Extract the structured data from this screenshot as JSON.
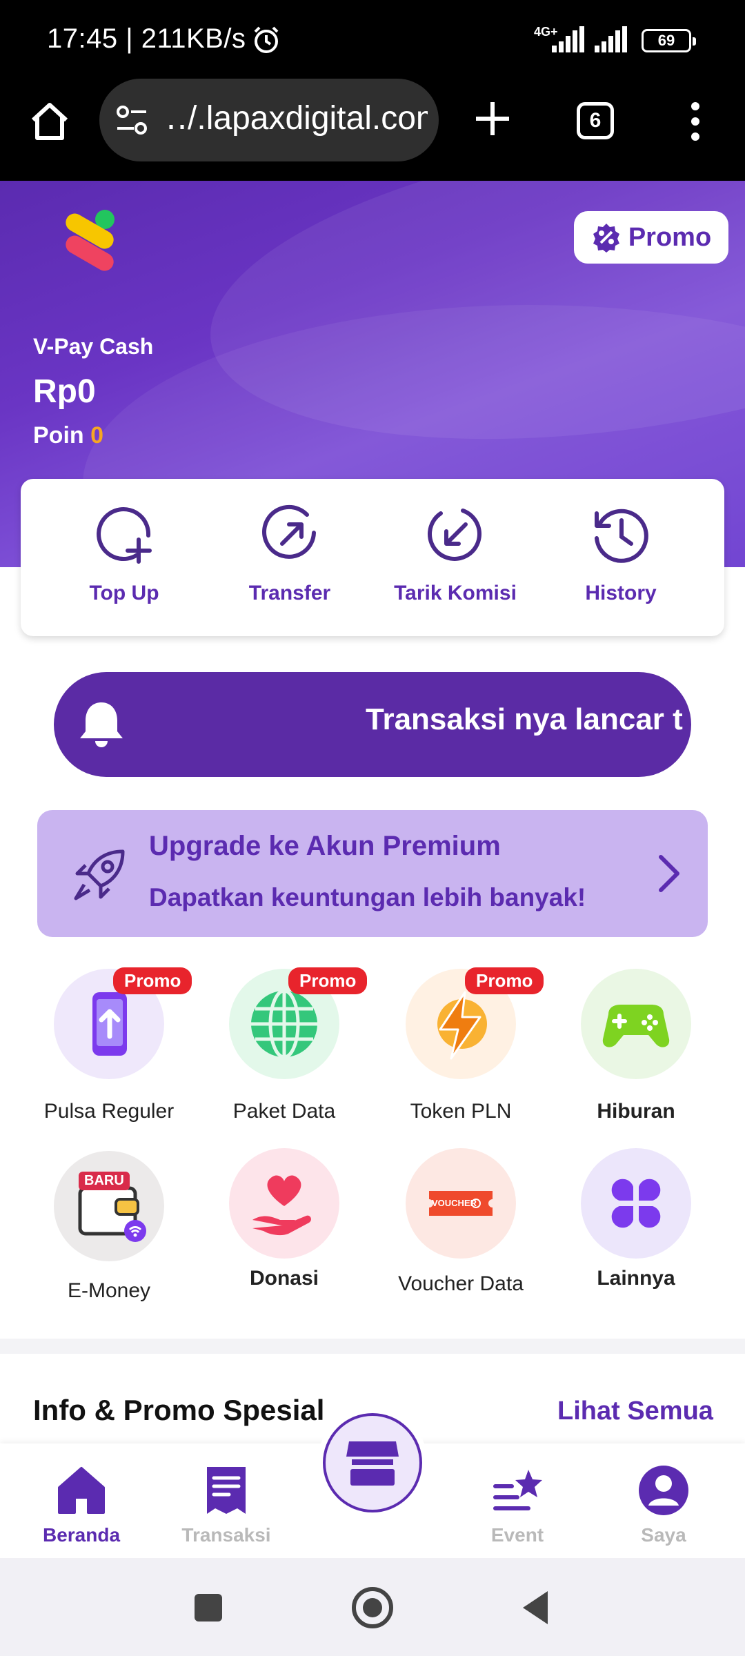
{
  "status_bar": {
    "time": "17:45 | 211KB/s",
    "network": "4G+",
    "battery": "69"
  },
  "browser": {
    "url": "‥/.lapaxdigital.com",
    "tab_count": "6"
  },
  "hero": {
    "promo_label": "Promo",
    "wallet_label": "V-Pay Cash",
    "balance": "Rp0",
    "points_label": "Poin",
    "points_value": "0"
  },
  "actions": [
    {
      "label": "Top Up",
      "icon": "add-circle-icon"
    },
    {
      "label": "Transfer",
      "icon": "transfer-arrow-icon"
    },
    {
      "label": "Tarik Komisi",
      "icon": "withdraw-arrow-icon"
    },
    {
      "label": "History",
      "icon": "history-clock-icon"
    }
  ],
  "notification": {
    "message": "Transaksi nya lancar t"
  },
  "premium": {
    "title": "Upgrade ke Akun Premium",
    "subtitle": "Dapatkan keuntungan lebih banyak!"
  },
  "services": [
    {
      "label": "Pulsa Reguler",
      "badge": "Promo"
    },
    {
      "label": "Paket Data",
      "badge": "Promo"
    },
    {
      "label": "Token PLN",
      "badge": "Promo"
    },
    {
      "label": "Hiburan",
      "badge": ""
    },
    {
      "label": "E-Money",
      "badge": "BARU"
    },
    {
      "label": "Donasi",
      "badge": ""
    },
    {
      "label": "Voucher Data",
      "badge": "",
      "card_text": "VOUCHER"
    },
    {
      "label": "Lainnya",
      "badge": ""
    }
  ],
  "info": {
    "title": "Info & Promo Spesial",
    "more": "Lihat Semua"
  },
  "bottom_nav": [
    {
      "label": "Beranda",
      "active": true
    },
    {
      "label": "Transaksi",
      "active": false
    },
    {
      "label": "Event",
      "active": false
    },
    {
      "label": "Saya",
      "active": false
    }
  ],
  "colors": {
    "brand": "#5b2bb0",
    "promo_badge": "#e8242c",
    "points": "#f6a623"
  }
}
